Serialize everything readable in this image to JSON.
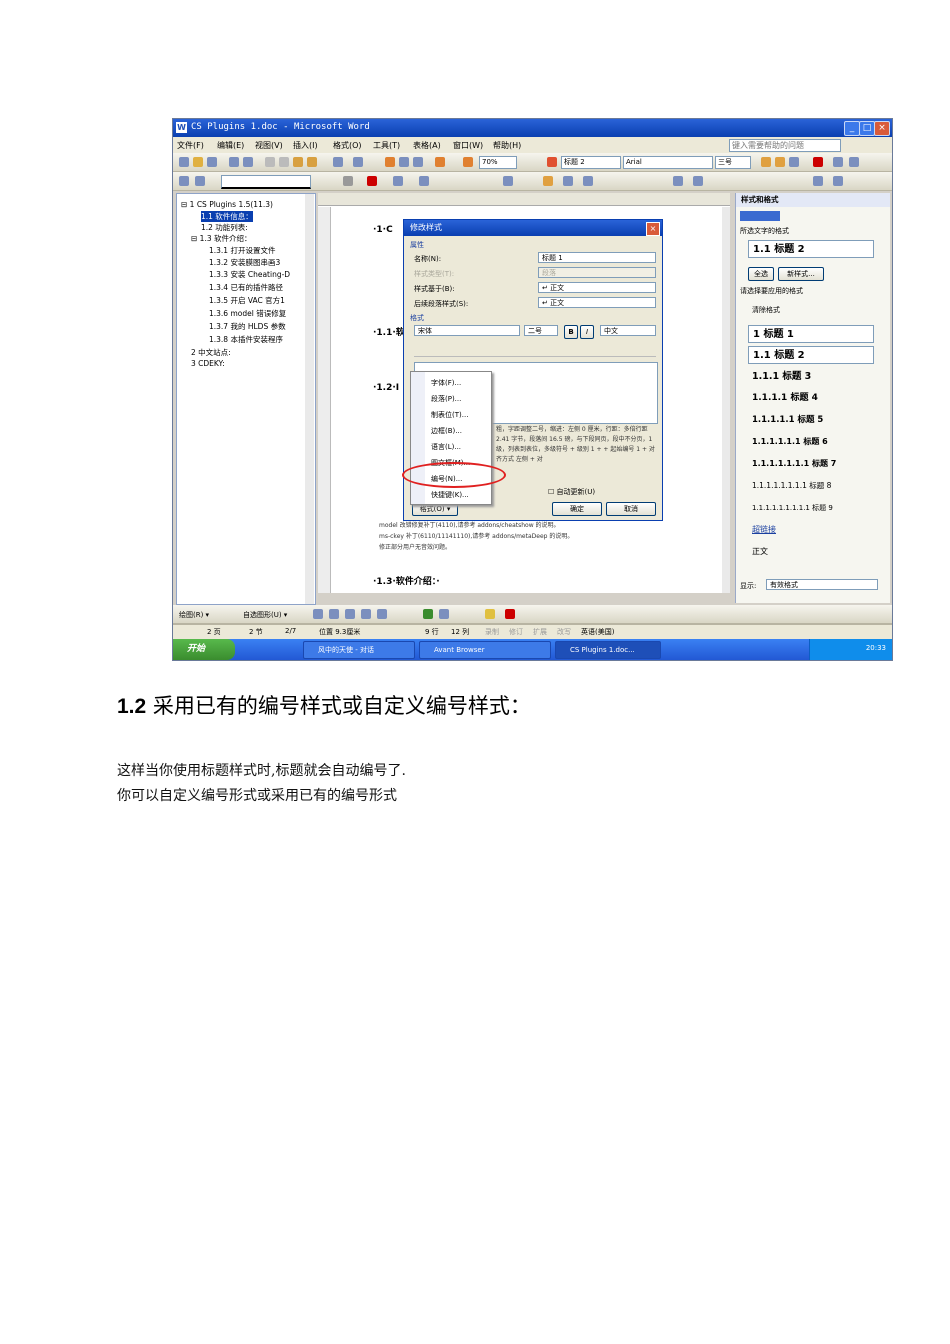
{
  "screenshot": {
    "window_title": "CS Plugins 1.doc - Microsoft Word",
    "help_box": "键入需要帮助的问题",
    "menu": [
      "文件(F)",
      "编辑(E)",
      "视图(V)",
      "插入(I)",
      "格式(O)",
      "工具(T)",
      "表格(A)",
      "窗口(W)",
      "帮助(H)"
    ],
    "toolbar": {
      "zoom": "70%",
      "style_box": "标题 2",
      "font_box": "Arial",
      "size_box": "三号"
    },
    "nav_items": [
      "⊟ 1 CS Plugins 1.5(11.3)",
      "1.1 软件信息：",
      "1.2 功能列表:",
      "⊟ 1.3 软件介绍：",
      "1.3.1 打开设置文件",
      "1.3.2 安装膜图串画3",
      "1.3.3 安装 Cheating-D",
      "1.3.4 已有的插件路径",
      "1.3.5 开启 VAC 官方1",
      "1.3.6 model 错误修复",
      "1.3.7 我的 HLDS 参数",
      "1.3.8 本插件安装程序",
      "2 中文站点:",
      "3 CDEKY:"
    ],
    "doc_headings": [
      "·1·C",
      "·1.1·软",
      "·1.2·I",
      "·1.3·软件介绍：·"
    ],
    "doc_lines": [
      "model 改错修复补丁(4110),请参考 addons/cheatshow 的说明。",
      "ms-ckey 补丁(6110/11141110),请参考 addons/metaDeep 的说明。",
      "修正部分用户无音效问题。"
    ],
    "dialog": {
      "title": "修改样式",
      "section_props": "属性",
      "name_label": "名称(N):",
      "name_value": "标题 1",
      "type_label": "样式类型(T):",
      "type_value": "段落",
      "based_label": "样式基于(B):",
      "based_value": "↵ 正文",
      "next_label": "后续段落样式(S):",
      "next_value": "↵ 正文",
      "section_format": "格式",
      "font_value": "宋体",
      "size_value": "二号",
      "lang_value": "中文",
      "desc": "粗，字距调整二号，缩进：左侧 0 厘米，行距：多倍行距 2.41 字节，段落间 16.5 磅，与下段同页，段中不分页，1 级，列表到表位，多级符号 + 级别 1 + + 起始编号 1 + 对齐方式 左侧 + 对",
      "auto_update": "自动更新(U)",
      "format_btn": "格式(O) ▾",
      "ok_btn": "确定",
      "cancel_btn": "取消",
      "popup": [
        "字体(F)...",
        "段落(P)...",
        "制表位(T)...",
        "边框(B)...",
        "语言(L)...",
        "图文框(M)...",
        "编号(N)...",
        "快捷键(K)..."
      ]
    },
    "taskpane": {
      "title": "样式和格式",
      "selected_label": "所选文字的格式",
      "selected_style": "1.1 标题 2",
      "select_all": "全选",
      "new_style": "新样式...",
      "apply_label": "请选择要应用的格式",
      "clear": "清除格式",
      "styles": [
        "1 标题 1",
        "1.1 标题 2",
        "1.1.1 标题 3",
        "1.1.1.1 标题 4",
        "1.1.1.1.1 标题 5",
        "1.1.1.1.1.1 标题 6",
        "1.1.1.1.1.1.1 标题 7",
        "1.1.1.1.1.1.1.1 标题 8",
        "1.1.1.1.1.1.1.1.1 标题 9",
        "超链接",
        "正文"
      ],
      "show_label": "显示:",
      "show_value": "有效格式"
    },
    "drawbar": {
      "draw": "绘图(R) ▾",
      "autoshape": "自选图形(U) ▾"
    },
    "status": [
      "2 页",
      "2 节",
      "2/7",
      "位置 9.3厘米",
      "9 行",
      "12 列",
      "录制",
      "修订",
      "扩展",
      "改写",
      "英语(美国)"
    ],
    "taskbar": {
      "start": "开始",
      "tasks": [
        "风中的天使 - 对话",
        "Avant Browser",
        "CS Plugins 1.doc..."
      ],
      "clock": "20:33"
    }
  },
  "page": {
    "heading_num": "1.2",
    "heading_text": "采用已有的编号样式或自定义编号样式：",
    "para1": "这样当你使用标题样式时,标题就会自动编号了.",
    "para2": "你可以自定义编号形式或采用已有的编号形式"
  }
}
